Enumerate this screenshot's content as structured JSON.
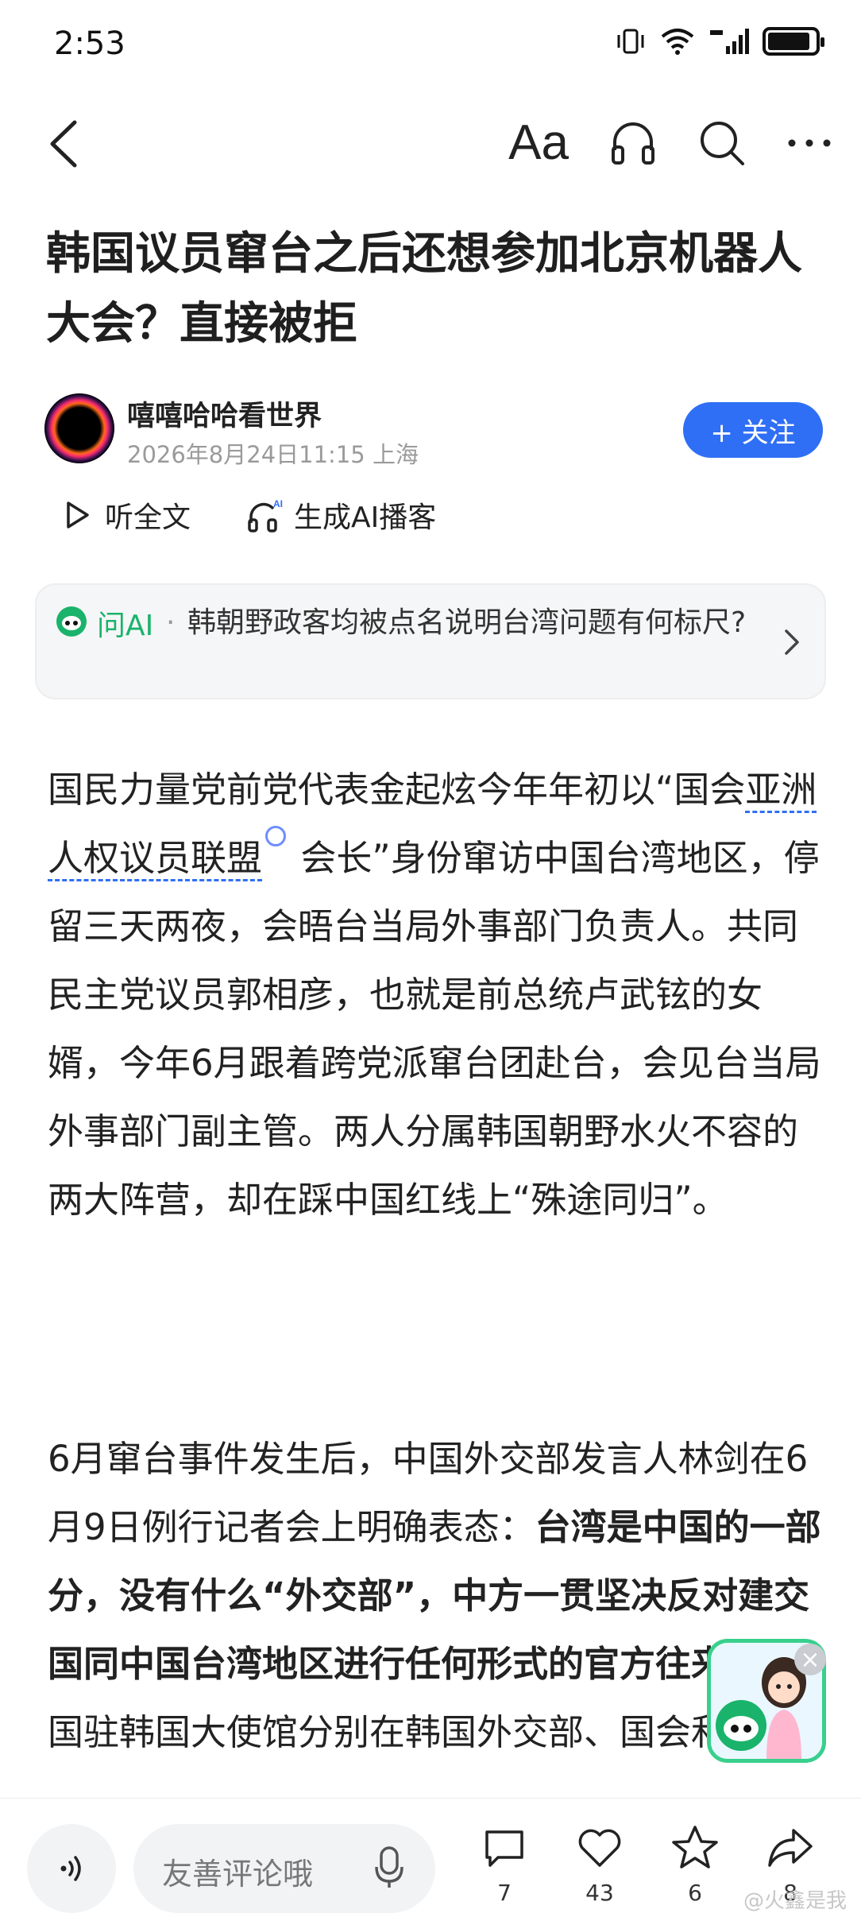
{
  "status_bar": {
    "time": "2:53"
  },
  "nav": {
    "font_label": "Aa"
  },
  "article": {
    "title": "韩国议员窜台之后还想参加北京机器人大会？直接被拒",
    "author": "嘻嘻哈哈看世界",
    "meta": "2026年8月24日11:15 上海",
    "follow_label": "+ 关注",
    "listen_label": "听全文",
    "podcast_label": "生成AI播客",
    "ai": {
      "label": "问AI",
      "dot": "·",
      "question": "韩朝野政客均被点名说明台湾问题有何标尺?"
    },
    "para1": {
      "part1": "国民力量党前党代表金起炫今年年初以“国会",
      "link": "亚洲人权议员联盟",
      "part2": " 会长”身份窜访中国台湾地区，停留三天两夜，会晤台当局外事部门负责人。共同民主党议员郭相彦，也就是前总统卢武铉的女婿，今年6月跟着跨党派窜台团赴台，会见台当局外事部门副主管。两人分属韩国朝野水火不容的两大阵营，却在踩中国红线上“殊途同归”。"
    },
    "para2": {
      "normal": "6月窜台事件发生后，中国外交部发言人林剑在6月9日例行记者会上明确表态：",
      "bold": "台湾是中国的一部分，没有什么“外交部”，中方一贯坚决反对建交国同中国台湾地区进行任何形式的官方往来。",
      "tail": "中国驻韩国大使馆分别在韩国外交部、国会和相"
    }
  },
  "bottom_bar": {
    "comment_placeholder": "友善评论哦",
    "comment_count": "7",
    "like_count": "43",
    "favorite_count": "6",
    "share_count": "8",
    "watermark": "@火鑫是我"
  },
  "colors": {
    "accent": "#2f6ff5",
    "ai_green": "#1ab36b"
  },
  "icons": [
    "back-icon",
    "headphones-icon",
    "search-icon",
    "more-icon",
    "play-icon",
    "ai-podcast-icon",
    "ai-logo-icon",
    "chevron-right-icon",
    "voice-icon",
    "mic-icon",
    "comment-icon",
    "heart-icon",
    "star-icon",
    "share-icon"
  ]
}
